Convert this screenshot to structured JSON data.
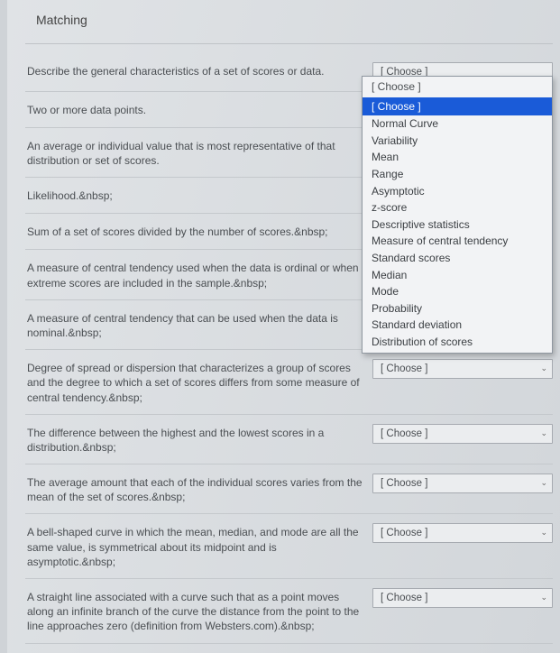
{
  "title": "Matching",
  "choose_label": "[ Choose ]",
  "dropdown_selected": "[ Choose ]",
  "dropdown_options": [
    "Normal Curve",
    "Variability",
    "Mean",
    "Range",
    "Asymptotic",
    "z-score",
    "Descriptive statistics",
    "Measure of central tendency",
    "Standard scores",
    "Median",
    "Mode",
    "Probability",
    "Standard deviation",
    "Distribution of scores"
  ],
  "items": [
    {
      "prompt": "Describe the general characteristics of a set of scores or data."
    },
    {
      "prompt": "Two or more data points."
    },
    {
      "prompt": "An average or individual value that is most representative of that distribution or set of scores."
    },
    {
      "prompt": "Likelihood.&nbsp;"
    },
    {
      "prompt": "Sum of a set of scores divided by the number of scores.&nbsp;"
    },
    {
      "prompt": "A measure of central tendency used when the data is ordinal or when extreme scores are included in the sample.&nbsp;"
    },
    {
      "prompt": "A measure of central tendency that can be used when the data is nominal.&nbsp;"
    },
    {
      "prompt": "Degree of spread or dispersion that characterizes a group of scores and the degree to which a set of scores differs from some measure of central tendency.&nbsp;"
    },
    {
      "prompt": "The difference between the highest and the lowest scores in a distribution.&nbsp;"
    },
    {
      "prompt": "The average amount that each of the individual scores varies from the mean of the set of scores.&nbsp;"
    },
    {
      "prompt": "A bell-shaped curve in which the mean, median, and mode are all the same value, is symmetrical about its midpoint and is asymptotic.&nbsp;"
    },
    {
      "prompt": "A straight line associated with a curve such that as a point moves along an infinite branch of the curve the distance from the point to the line approaches zero (definition from Websters.com).&nbsp;"
    }
  ]
}
